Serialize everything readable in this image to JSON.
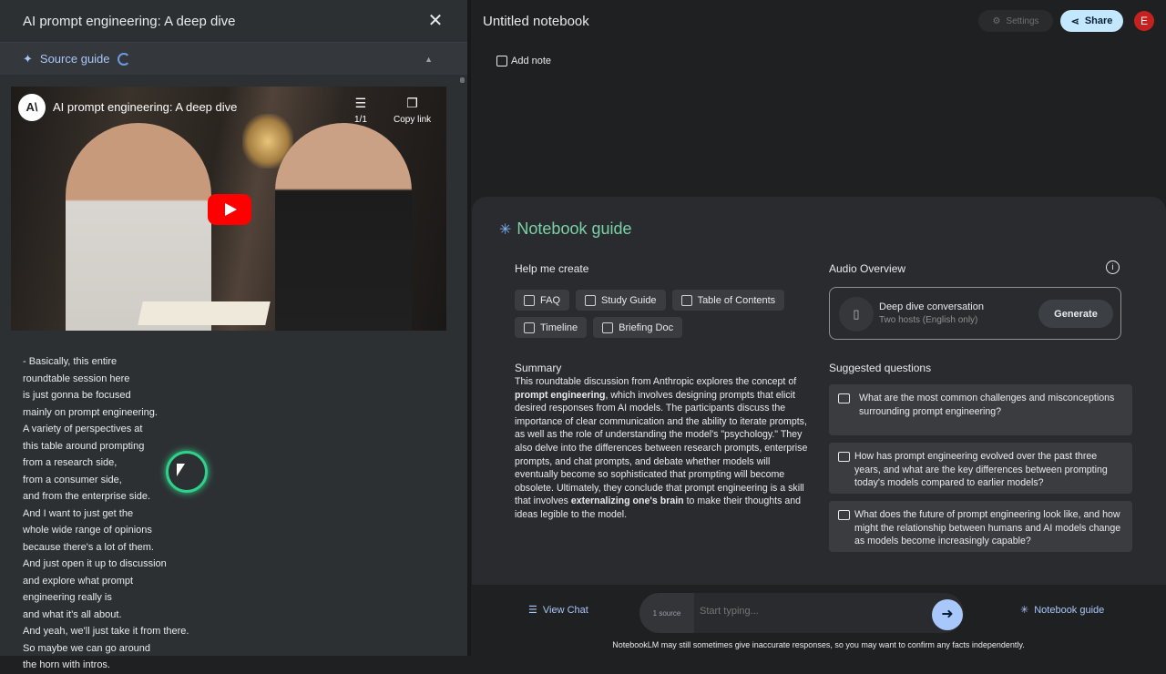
{
  "source_panel": {
    "title": "AI prompt engineering: A deep dive",
    "source_guide_label": "Source guide",
    "video": {
      "channel_logo": "A\\",
      "title": "AI prompt engineering: A deep dive",
      "playlist_count": "1/1",
      "copy_link_label": "Copy link"
    },
    "transcript": [
      "- Basically, this entire",
      "roundtable session here",
      "is just gonna be focused",
      "mainly on prompt engineering.",
      "A variety of perspectives at",
      "this table around prompting",
      "from a research side,",
      "from a consumer side,",
      "and from the enterprise side.",
      "And I want to just get the",
      "whole wide range of opinions",
      "because there's a lot of them.",
      "And just open it up to discussion",
      "and explore what prompt",
      "engineering really is",
      "and what it's all about.",
      "And yeah, we'll just take it from there.",
      "So maybe we can go around",
      "the horn with intros."
    ]
  },
  "header": {
    "notebook_title": "Untitled notebook",
    "settings_label": "Settings",
    "share_label": "Share",
    "avatar_initial": "E"
  },
  "notes": {
    "add_note_label": "Add note"
  },
  "notebook_guide": {
    "title": "Notebook guide",
    "help_me_create_label": "Help me create",
    "chips": [
      "FAQ",
      "Study Guide",
      "Table of Contents",
      "Timeline",
      "Briefing Doc"
    ],
    "summary_heading": "Summary",
    "summary_parts": [
      "This roundtable discussion from Anthropic explores the concept of ",
      "prompt engineering",
      ", which involves designing prompts that elicit desired responses from AI models. The participants discuss the importance of clear communication and the ability to iterate prompts, as well as the role of understanding the model's \"psychology.\" They also delve into the differences between research prompts, enterprise prompts, and chat prompts, and debate whether models will eventually become so sophisticated that prompting will become obsolete. Ultimately, they conclude that prompt engineering is a skill that involves ",
      "externalizing one's brain",
      " to make their thoughts and ideas legible to the model."
    ],
    "audio_overview_label": "Audio Overview",
    "audio_card": {
      "title": "Deep dive conversation",
      "subtitle": "Two hosts (English only)",
      "generate_label": "Generate"
    },
    "suggested_questions_label": "Suggested questions",
    "suggested_questions": [
      "What are the most common challenges and misconceptions surrounding prompt engineering?",
      "How has prompt engineering evolved over the past three years, and what are the key differences between prompting today's models compared to earlier models?",
      "What does the future of prompt engineering look like, and how might the relationship between humans and AI models change as models become increasingly capable?"
    ]
  },
  "chat_bar": {
    "view_chat_label": "View Chat",
    "source_count": "1 source",
    "placeholder": "Start typing...",
    "notebook_guide_label": "Notebook guide",
    "disclaimer": "NotebookLM may still sometimes give inaccurate responses, so you may want to confirm any facts independently."
  }
}
